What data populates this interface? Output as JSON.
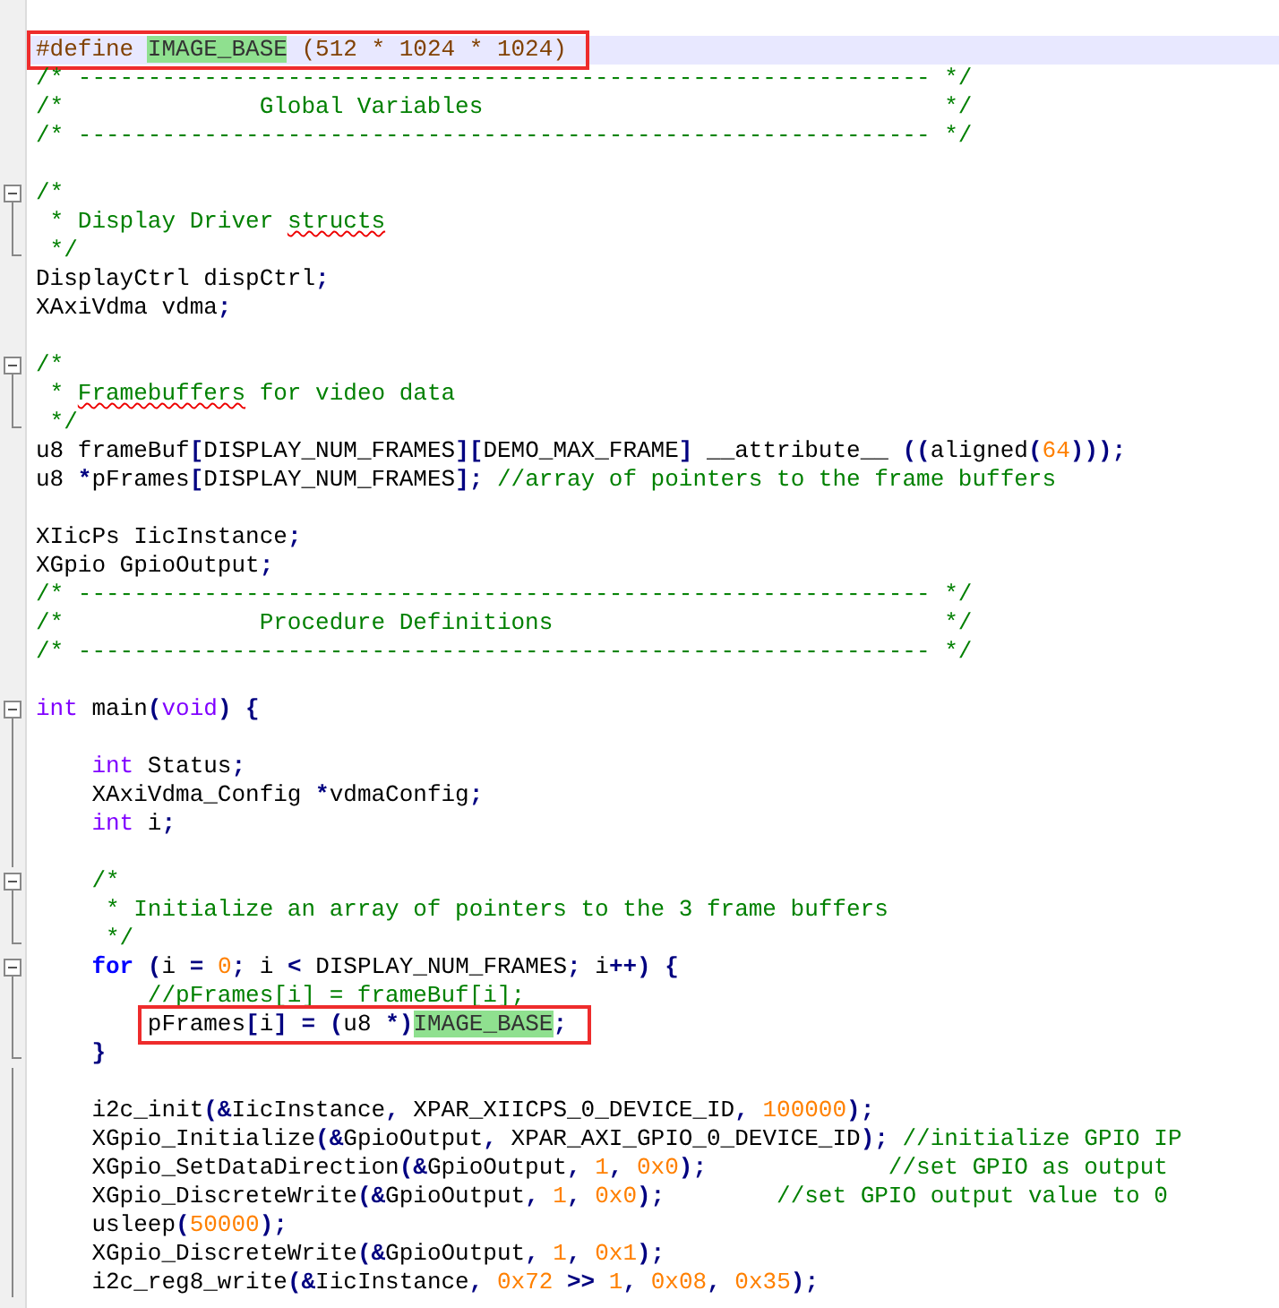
{
  "editor": {
    "lines": [
      {
        "current": true,
        "boxed": true,
        "tokens": [
          {
            "kind": "pre",
            "text": "#define "
          },
          {
            "kind": "hl",
            "text": "IMAGE_BASE"
          },
          {
            "kind": "pre",
            "text": " (512 * 1024 * 1024)"
          }
        ]
      },
      {
        "tokens": [
          {
            "kind": "comment",
            "text": "/* ------------------------------------------------------------- */"
          }
        ]
      },
      {
        "tokens": [
          {
            "kind": "comment",
            "text": "/*              Global Variables                                 */"
          }
        ]
      },
      {
        "tokens": [
          {
            "kind": "comment",
            "text": "/* ------------------------------------------------------------- */"
          }
        ]
      },
      {
        "space_above": true,
        "fold_start": true,
        "tokens": [
          {
            "kind": "comment",
            "text": "/*"
          }
        ]
      },
      {
        "in_fold": true,
        "tokens": [
          {
            "kind": "comment",
            "text": " * Display Driver "
          },
          {
            "kind": "typo",
            "text": "structs"
          }
        ]
      },
      {
        "fold_end": true,
        "tokens": [
          {
            "kind": "comment",
            "text": " */"
          }
        ]
      },
      {
        "tokens": [
          {
            "kind": "plain",
            "text": "DisplayCtrl dispCtrl"
          },
          {
            "kind": "op",
            "text": ";"
          }
        ]
      },
      {
        "tokens": [
          {
            "kind": "plain",
            "text": "XAxiVdma vdma"
          },
          {
            "kind": "op",
            "text": ";"
          }
        ]
      },
      {
        "space_above": true,
        "fold_start": true,
        "tokens": [
          {
            "kind": "comment",
            "text": "/*"
          }
        ]
      },
      {
        "in_fold": true,
        "tokens": [
          {
            "kind": "comment",
            "text": " * "
          },
          {
            "kind": "typo",
            "text": "Framebuffers"
          },
          {
            "kind": "comment",
            "text": " for video data"
          }
        ]
      },
      {
        "fold_end": true,
        "tokens": [
          {
            "kind": "comment",
            "text": " */"
          }
        ]
      },
      {
        "tokens": [
          {
            "kind": "plain",
            "text": "u8 frameBuf"
          },
          {
            "kind": "op",
            "text": "["
          },
          {
            "kind": "plain",
            "text": "DISPLAY_NUM_FRAMES"
          },
          {
            "kind": "op",
            "text": "]["
          },
          {
            "kind": "plain",
            "text": "DEMO_MAX_FRAME"
          },
          {
            "kind": "op",
            "text": "]"
          },
          {
            "kind": "plain",
            "text": " __attribute__ "
          },
          {
            "kind": "op",
            "text": "(("
          },
          {
            "kind": "plain",
            "text": "aligned"
          },
          {
            "kind": "op",
            "text": "("
          },
          {
            "kind": "num",
            "text": "64"
          },
          {
            "kind": "op",
            "text": ")));"
          }
        ]
      },
      {
        "tokens": [
          {
            "kind": "plain",
            "text": "u8 "
          },
          {
            "kind": "op",
            "text": "*"
          },
          {
            "kind": "plain",
            "text": "pFrames"
          },
          {
            "kind": "op",
            "text": "["
          },
          {
            "kind": "plain",
            "text": "DISPLAY_NUM_FRAMES"
          },
          {
            "kind": "op",
            "text": "];"
          },
          {
            "kind": "comment",
            "text": " //array of pointers to the frame buffers"
          }
        ]
      },
      {
        "space_above": true,
        "tokens": [
          {
            "kind": "plain",
            "text": "XIicPs IicInstance"
          },
          {
            "kind": "op",
            "text": ";"
          }
        ]
      },
      {
        "tokens": [
          {
            "kind": "plain",
            "text": "XGpio GpioOutput"
          },
          {
            "kind": "op",
            "text": ";"
          }
        ]
      },
      {
        "tokens": [
          {
            "kind": "comment",
            "text": "/* ------------------------------------------------------------- */"
          }
        ]
      },
      {
        "tokens": [
          {
            "kind": "comment",
            "text": "/*              Procedure Definitions                            */"
          }
        ]
      },
      {
        "tokens": [
          {
            "kind": "comment",
            "text": "/* ------------------------------------------------------------- */"
          }
        ]
      },
      {
        "space_above": true,
        "fold_start": true,
        "tokens": [
          {
            "kind": "type",
            "text": "int"
          },
          {
            "kind": "plain",
            "text": " main"
          },
          {
            "kind": "op",
            "text": "("
          },
          {
            "kind": "type",
            "text": "void"
          },
          {
            "kind": "op",
            "text": ") {"
          }
        ]
      },
      {
        "in_fold": true
      },
      {
        "in_fold": true,
        "tokens": [
          {
            "kind": "type",
            "text": "    int"
          },
          {
            "kind": "plain",
            "text": " Status"
          },
          {
            "kind": "op",
            "text": ";"
          }
        ]
      },
      {
        "in_fold": true,
        "tokens": [
          {
            "kind": "plain",
            "text": "    XAxiVdma_Config "
          },
          {
            "kind": "op",
            "text": "*"
          },
          {
            "kind": "plain",
            "text": "vdmaConfig"
          },
          {
            "kind": "op",
            "text": ";"
          }
        ]
      },
      {
        "in_fold": true,
        "tokens": [
          {
            "kind": "type",
            "text": "    int"
          },
          {
            "kind": "plain",
            "text": " i"
          },
          {
            "kind": "op",
            "text": ";"
          }
        ]
      },
      {
        "in_fold": true
      },
      {
        "fold_start": true,
        "tokens": [
          {
            "kind": "comment",
            "text": "    /*"
          }
        ]
      },
      {
        "in_fold": true,
        "tokens": [
          {
            "kind": "comment",
            "text": "     * Initialize an array of pointers to the 3 frame buffers"
          }
        ]
      },
      {
        "fold_end": true,
        "tokens": [
          {
            "kind": "comment",
            "text": "     */"
          }
        ]
      },
      {
        "fold_start": true,
        "tokens": [
          {
            "kind": "kw",
            "text": "    for"
          },
          {
            "kind": "op",
            "text": " ("
          },
          {
            "kind": "plain",
            "text": "i "
          },
          {
            "kind": "op",
            "text": "= "
          },
          {
            "kind": "num",
            "text": "0"
          },
          {
            "kind": "op",
            "text": "; "
          },
          {
            "kind": "plain",
            "text": "i "
          },
          {
            "kind": "op",
            "text": "< "
          },
          {
            "kind": "plain",
            "text": "DISPLAY_NUM_FRAMES"
          },
          {
            "kind": "op",
            "text": "; "
          },
          {
            "kind": "plain",
            "text": "i"
          },
          {
            "kind": "op",
            "text": "++) {"
          }
        ]
      },
      {
        "in_fold": true,
        "tokens": [
          {
            "kind": "comment",
            "text": "        //pFrames[i] = frameBuf[i];"
          }
        ]
      },
      {
        "in_fold": true,
        "boxed": true,
        "tokens": [
          {
            "kind": "plain",
            "text": "        pFrames"
          },
          {
            "kind": "op",
            "text": "["
          },
          {
            "kind": "plain",
            "text": "i"
          },
          {
            "kind": "op",
            "text": "] = ("
          },
          {
            "kind": "plain",
            "text": "u8 "
          },
          {
            "kind": "op",
            "text": "*)"
          },
          {
            "kind": "hl",
            "text": "IMAGE_BASE"
          },
          {
            "kind": "op",
            "text": ";"
          }
        ]
      },
      {
        "fold_end": true,
        "tokens": [
          {
            "kind": "op",
            "text": "    }"
          }
        ]
      },
      {
        "in_fold": true
      },
      {
        "in_fold": true,
        "tokens": [
          {
            "kind": "plain",
            "text": "    i2c_init"
          },
          {
            "kind": "op",
            "text": "(&"
          },
          {
            "kind": "plain",
            "text": "IicInstance"
          },
          {
            "kind": "op",
            "text": ","
          },
          {
            "kind": "plain",
            "text": " XPAR_XIICPS_0_DEVICE_ID"
          },
          {
            "kind": "op",
            "text": ", "
          },
          {
            "kind": "num",
            "text": "100000"
          },
          {
            "kind": "op",
            "text": ");"
          }
        ]
      },
      {
        "in_fold": true,
        "tokens": [
          {
            "kind": "plain",
            "text": "    XGpio_Initialize"
          },
          {
            "kind": "op",
            "text": "(&"
          },
          {
            "kind": "plain",
            "text": "GpioOutput"
          },
          {
            "kind": "op",
            "text": ","
          },
          {
            "kind": "plain",
            "text": " XPAR_AXI_GPIO_0_DEVICE_ID"
          },
          {
            "kind": "op",
            "text": ");"
          },
          {
            "kind": "comment",
            "text": " //initialize GPIO IP"
          }
        ]
      },
      {
        "in_fold": true,
        "tokens": [
          {
            "kind": "plain",
            "text": "    XGpio_SetDataDirection"
          },
          {
            "kind": "op",
            "text": "(&"
          },
          {
            "kind": "plain",
            "text": "GpioOutput"
          },
          {
            "kind": "op",
            "text": ", "
          },
          {
            "kind": "num",
            "text": "1"
          },
          {
            "kind": "op",
            "text": ", "
          },
          {
            "kind": "num",
            "text": "0x0"
          },
          {
            "kind": "op",
            "text": ");"
          },
          {
            "kind": "comment",
            "text": "             //set GPIO as output"
          }
        ]
      },
      {
        "in_fold": true,
        "tokens": [
          {
            "kind": "plain",
            "text": "    XGpio_DiscreteWrite"
          },
          {
            "kind": "op",
            "text": "(&"
          },
          {
            "kind": "plain",
            "text": "GpioOutput"
          },
          {
            "kind": "op",
            "text": ", "
          },
          {
            "kind": "num",
            "text": "1"
          },
          {
            "kind": "op",
            "text": ", "
          },
          {
            "kind": "num",
            "text": "0x0"
          },
          {
            "kind": "op",
            "text": ");"
          },
          {
            "kind": "comment",
            "text": "        //set GPIO output value to 0"
          }
        ]
      },
      {
        "in_fold": true,
        "tokens": [
          {
            "kind": "plain",
            "text": "    usleep"
          },
          {
            "kind": "op",
            "text": "("
          },
          {
            "kind": "num",
            "text": "50000"
          },
          {
            "kind": "op",
            "text": ");"
          }
        ]
      },
      {
        "in_fold": true,
        "tokens": [
          {
            "kind": "plain",
            "text": "    XGpio_DiscreteWrite"
          },
          {
            "kind": "op",
            "text": "(&"
          },
          {
            "kind": "plain",
            "text": "GpioOutput"
          },
          {
            "kind": "op",
            "text": ", "
          },
          {
            "kind": "num",
            "text": "1"
          },
          {
            "kind": "op",
            "text": ", "
          },
          {
            "kind": "num",
            "text": "0x1"
          },
          {
            "kind": "op",
            "text": ");"
          }
        ]
      },
      {
        "in_fold": true,
        "tokens": [
          {
            "kind": "plain",
            "text": "    i2c_reg8_write"
          },
          {
            "kind": "op",
            "text": "(&"
          },
          {
            "kind": "plain",
            "text": "IicInstance"
          },
          {
            "kind": "op",
            "text": ", "
          },
          {
            "kind": "num",
            "text": "0x72"
          },
          {
            "kind": "op",
            "text": " >> "
          },
          {
            "kind": "num",
            "text": "1"
          },
          {
            "kind": "op",
            "text": ", "
          },
          {
            "kind": "num",
            "text": "0x08"
          },
          {
            "kind": "op",
            "text": ", "
          },
          {
            "kind": "num",
            "text": "0x35"
          },
          {
            "kind": "op",
            "text": ");"
          }
        ]
      }
    ]
  }
}
